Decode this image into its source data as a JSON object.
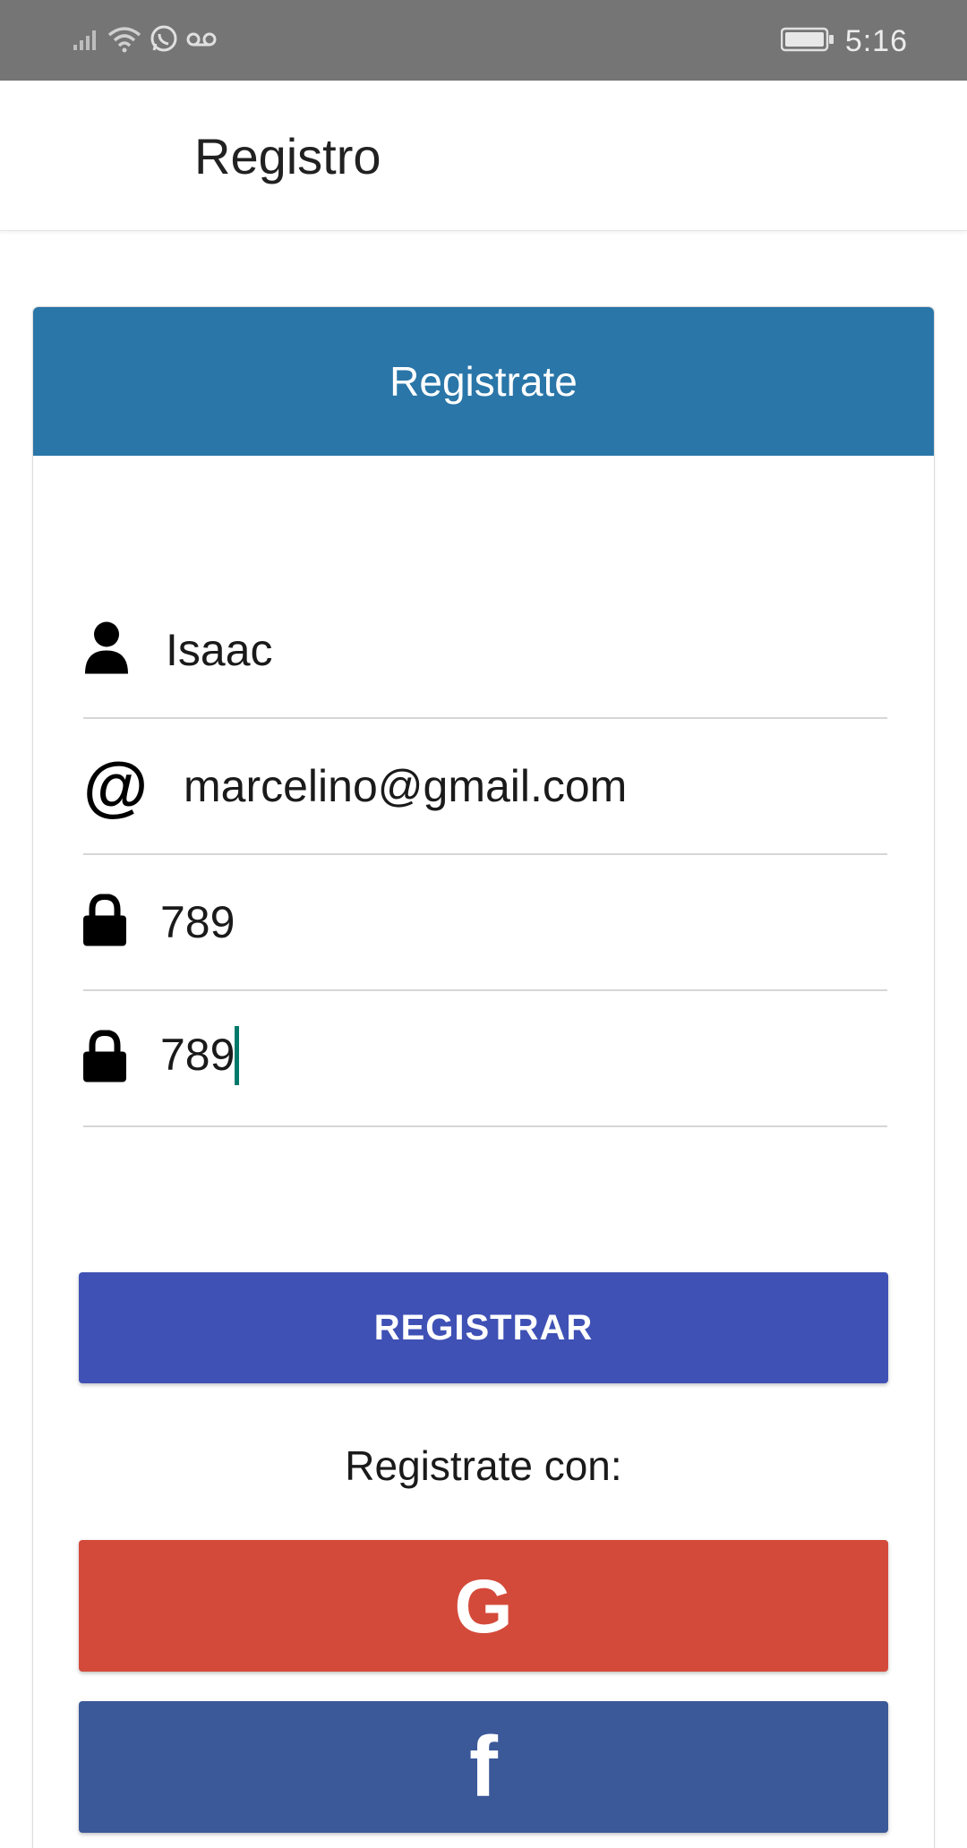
{
  "status_bar": {
    "time": "5:16"
  },
  "app_bar": {
    "title": "Registro"
  },
  "card": {
    "header": "Registrate",
    "fields": [
      {
        "icon": "user-icon",
        "value": "Isaac"
      },
      {
        "icon": "at-sign-icon",
        "value": "marcelino@gmail.com"
      },
      {
        "icon": "lock-icon",
        "value": "789"
      },
      {
        "icon": "lock-icon",
        "value": "789"
      }
    ],
    "at_glyph": "@",
    "register_button": "REGISTRAR",
    "register_with": "Registrate con:",
    "google_glyph": "G",
    "facebook_glyph": "f"
  },
  "colors": {
    "status_bar": "#757575",
    "card_header": "#2a76a8",
    "register_button": "#3f51b5",
    "google_button": "#d44a3a",
    "facebook_button": "#3b5998",
    "caret": "#00796b"
  }
}
